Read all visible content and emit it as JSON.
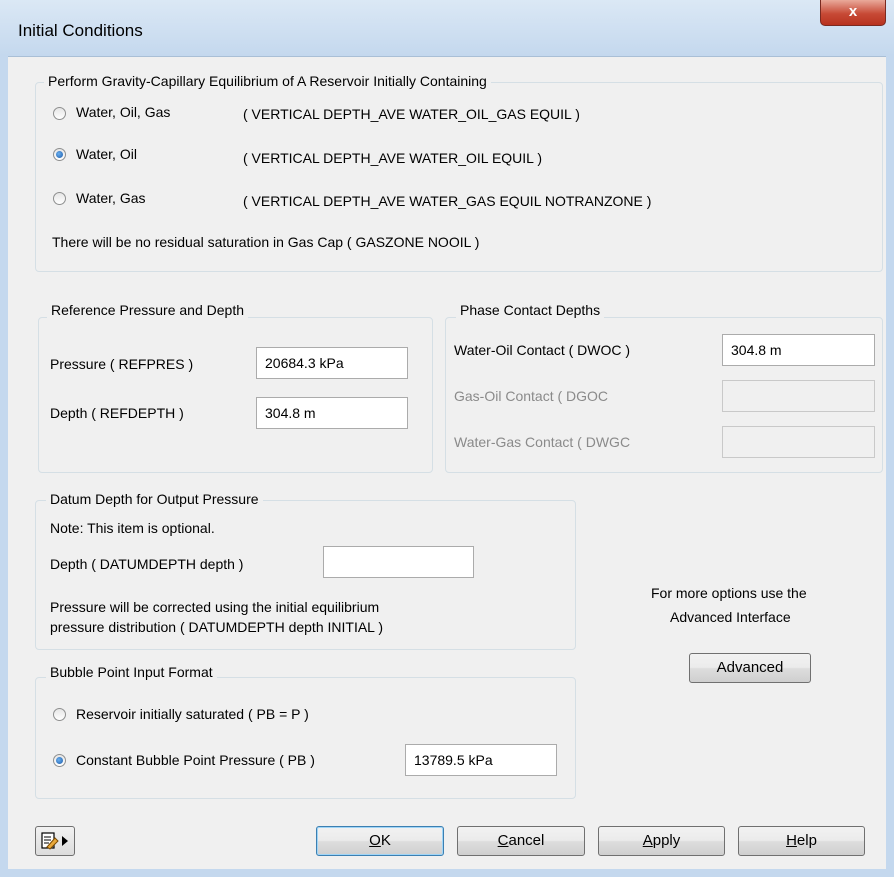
{
  "window": {
    "title": "Initial Conditions",
    "close_label": "x"
  },
  "equil_group": {
    "legend": "Perform Gravity-Capillary Equilibrium of A Reservoir Initially Containing",
    "options": [
      {
        "label": "Water, Oil, Gas",
        "keyword": "( VERTICAL DEPTH_AVE WATER_OIL_GAS EQUIL )",
        "selected": false
      },
      {
        "label": "Water, Oil",
        "keyword": "( VERTICAL DEPTH_AVE WATER_OIL EQUIL )",
        "selected": true
      },
      {
        "label": "Water, Gas",
        "keyword": "( VERTICAL DEPTH_AVE WATER_GAS EQUIL NOTRANZONE )",
        "selected": false
      }
    ],
    "note": "There will be no residual saturation in Gas Cap ( GASZONE NOOIL )"
  },
  "reference_group": {
    "legend": "Reference Pressure and Depth",
    "pressure_label": "Pressure ( REFPRES )",
    "pressure_value": "20684.3  kPa",
    "depth_label": "Depth ( REFDEPTH )",
    "depth_value": "304.8  m"
  },
  "contact_group": {
    "legend": "Phase Contact Depths",
    "dwoc_label": "Water-Oil Contact ( DWOC )",
    "dwoc_value": "304.8  m",
    "dgoc_label": "Gas-Oil Contact ( DGOC",
    "dgoc_value": "",
    "dwgc_label": "Water-Gas Contact ( DWGC",
    "dwgc_value": ""
  },
  "datum_group": {
    "legend": "Datum Depth for Output Pressure",
    "note": "Note: This item is optional.",
    "depth_label": "Depth ( DATUMDEPTH depth )",
    "depth_value": "",
    "description_line1": "Pressure will be corrected using the initial equilibrium",
    "description_line2": "pressure distribution ( DATUMDEPTH depth INITIAL )"
  },
  "bubble_group": {
    "legend": "Bubble Point Input Format",
    "option1_label": "Reservoir initially saturated ( PB = P )",
    "option1_selected": false,
    "option2_label": "Constant Bubble Point Pressure ( PB )",
    "option2_selected": true,
    "pb_value": "13789.5 kPa"
  },
  "advanced": {
    "text_line1": "For more options use the",
    "text_line2": "Advanced Interface",
    "button_label": "Advanced"
  },
  "footer": {
    "ok": {
      "mnemonic": "O",
      "rest": "K"
    },
    "cancel": {
      "mnemonic": "C",
      "rest": "ancel"
    },
    "apply": {
      "mnemonic": "A",
      "rest": "pply"
    },
    "help": {
      "mnemonic": "H",
      "rest": "elp"
    },
    "icon": "edit-document-arrow-icon"
  }
}
